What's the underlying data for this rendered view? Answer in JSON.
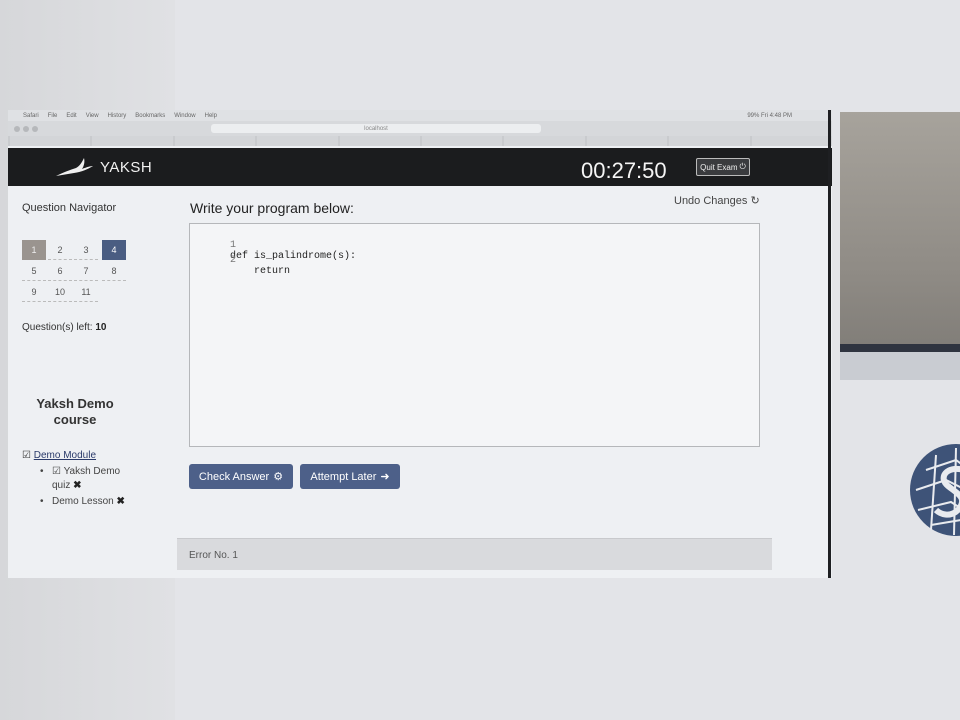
{
  "mac_menubar": {
    "items": [
      "Safari",
      "File",
      "Edit",
      "View",
      "History",
      "Bookmarks",
      "Window",
      "Help"
    ],
    "status": "99%  Fri 4:48 PM"
  },
  "browser": {
    "url": "localhost",
    "tabs": [
      "",
      "",
      "",
      "",
      "",
      "",
      "",
      "",
      "",
      ""
    ]
  },
  "header": {
    "brand": "YAKSH",
    "timer": "00:27:50",
    "quit_label": "Quit Exam"
  },
  "sidebar": {
    "nav_title": "Question Navigator",
    "questions": [
      "1",
      "2",
      "3",
      "4",
      "5",
      "6",
      "7",
      "8",
      "9",
      "10",
      "11"
    ],
    "current_question": "4",
    "questions_left_label": "Question(s) left:",
    "questions_left_value": "10",
    "course_title": "Yaksh Demo course",
    "module_label": "Demo Module",
    "lessons": [
      {
        "label": "Yaksh Demo quiz"
      },
      {
        "label": "Demo Lesson"
      }
    ]
  },
  "main": {
    "write_title": "Write your program below:",
    "undo_label": "Undo Changes",
    "code_lines": [
      {
        "num": "1",
        "text": "def is_palindrome(s):"
      },
      {
        "num": "2",
        "text": "    return"
      }
    ],
    "check_label": "Check Answer",
    "attempt_later_label": "Attempt Later",
    "error_text": "Error No. 1"
  },
  "colors": {
    "header_bg": "#1b1c1e",
    "button_bg": "#4d6089",
    "current_question": "#4a5d82"
  }
}
